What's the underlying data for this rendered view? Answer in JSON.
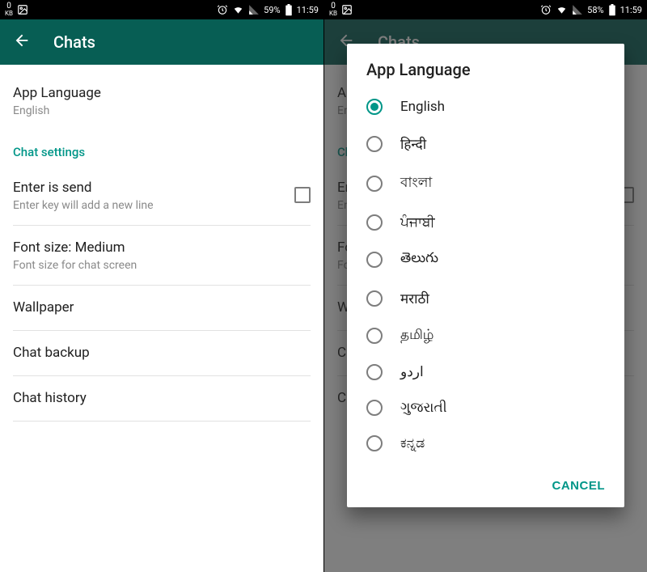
{
  "status_left_kb_num": "0",
  "status_left_kb_label": "KB",
  "statusbars": {
    "left": {
      "battery": "59%",
      "time": "11:59"
    },
    "right": {
      "battery": "58%",
      "time": "11:59"
    }
  },
  "screen1": {
    "action_title": "Chats",
    "app_language_title": "App Language",
    "app_language_value": "English",
    "chat_settings_header": "Chat settings",
    "enter_is_send_title": "Enter is send",
    "enter_is_send_sub": "Enter key will add a new line",
    "font_size_title": "Font size: Medium",
    "font_size_sub": "Font size for chat screen",
    "wallpaper_title": "Wallpaper",
    "chat_backup_title": "Chat backup",
    "chat_history_title": "Chat history"
  },
  "screen2": {
    "dialog_title": "App Language",
    "options": [
      "English",
      "हिन्दी",
      "বাংলা",
      "ਪੰਜਾਬੀ",
      "తెలుగు",
      "मराठी",
      "தமிழ்",
      "اردو",
      "ગુજરાતી",
      "ಕನ್ನಡ"
    ],
    "selected_index": 0,
    "cancel_label": "CANCEL"
  }
}
